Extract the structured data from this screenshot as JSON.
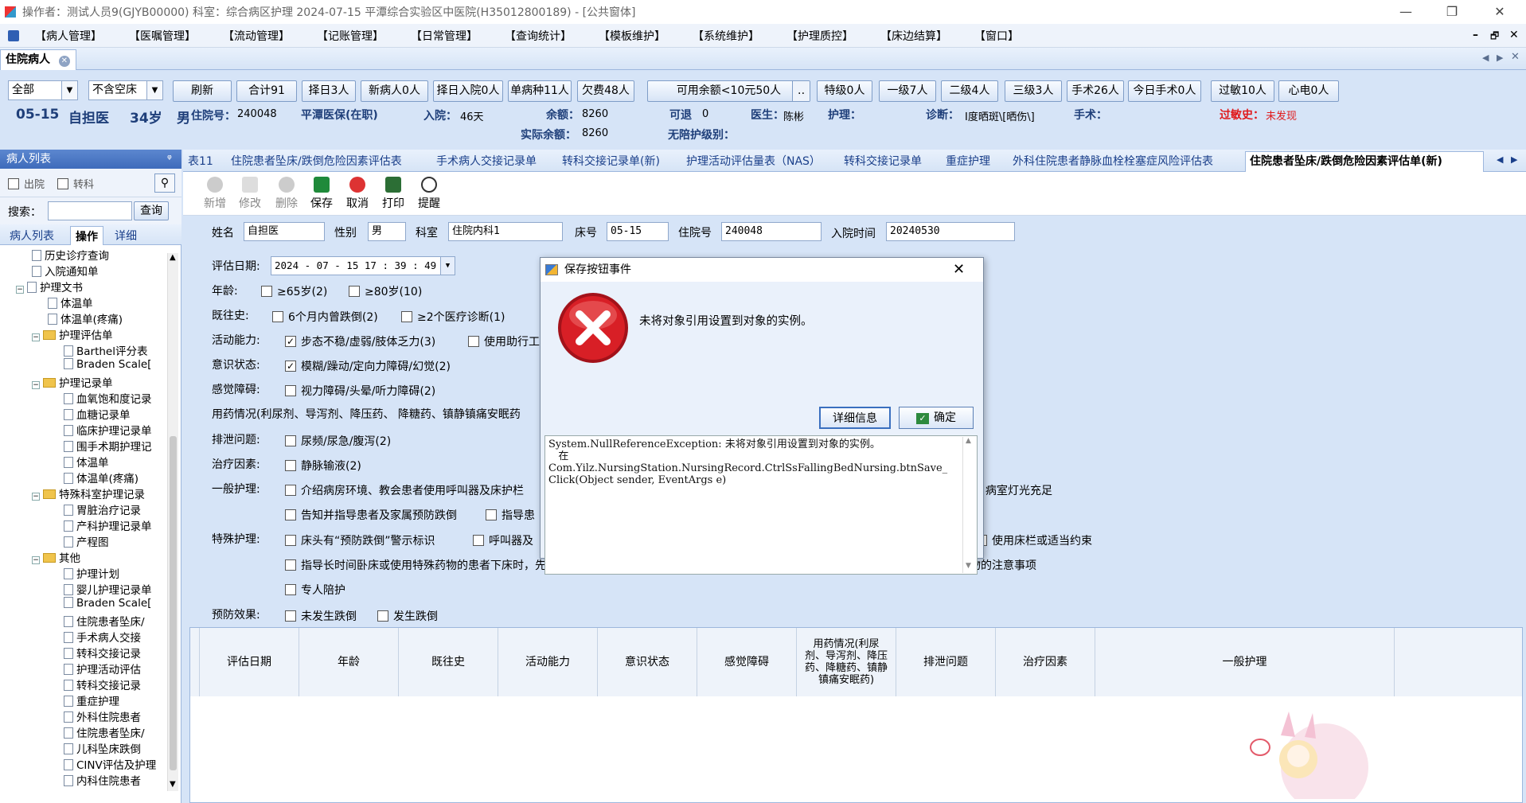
{
  "window": {
    "title": "操作者：测试人员9(GJYB00000) 科室：综合病区护理 2024-07-15 平潭综合实验区中医院(H35012800189) - [公共窗体]",
    "controls": [
      "—",
      "❐",
      "✕"
    ]
  },
  "menu": {
    "items": [
      "【病人管理】",
      "【医嘱管理】",
      "【流动管理】",
      "【记账管理】",
      "【日常管理】",
      "【查询统计】",
      "【模板维护】",
      "【系统维护】",
      "【护理质控】",
      "【床边结算】",
      "【窗口】"
    ],
    "right_controls": [
      "–",
      "🗗",
      "✕"
    ]
  },
  "main_tab": {
    "label": "住院病人"
  },
  "filters": {
    "scope": "全部",
    "bed_filter": "不含空床",
    "buttons": [
      "刷新",
      "合计91",
      "择日3人",
      "新病人0人",
      "择日入院0人",
      "单病种11人",
      "欠费48人",
      "可用余额<10元50人",
      "特级0人",
      "一级7人",
      "二级4人",
      "三级3人",
      "手术26人",
      "今日手术0人",
      "过敏10人",
      "心电0人"
    ]
  },
  "patient": {
    "bed": "05-15",
    "name": "自担医",
    "age": "34岁",
    "sex": "男",
    "admission_no_label": "住院号：",
    "admission_no": "240048",
    "insurance": "平潭医保(在职)",
    "admit_label": "入院：",
    "admit_days": "46天",
    "balance_label": "余额：",
    "balance": "8260",
    "actual_balance_label": "实际余额：",
    "actual_balance": "8260",
    "refund_label": "可退",
    "refund": "0",
    "doctor_label": "医生：",
    "doctor": "陈彬",
    "nurse_label": "护理：",
    "nurse": "",
    "no_escort_label": "无陪护级别：",
    "diagnosis_label": "诊断：",
    "diagnosis": "Ⅰ度晒斑\\[晒伤\\]",
    "surgery_label": "手术：",
    "allergy_label": "过敏史：",
    "allergy": "未发现"
  },
  "left_panel": {
    "title": "病人列表",
    "pin": "ᵠ",
    "discharged": "出院",
    "transfer": "转科",
    "search_label": "搜索：",
    "search_value": "",
    "query_button": "查询",
    "tabs": [
      "病人列表",
      "操作",
      "详细"
    ],
    "tree": [
      {
        "level": 1,
        "type": "doc",
        "label": "历史诊疗查询"
      },
      {
        "level": 1,
        "type": "doc",
        "label": "入院通知单"
      },
      {
        "level": 0,
        "type": "doc",
        "label": "护理文书",
        "expand": "−"
      },
      {
        "level": 2,
        "type": "doc",
        "label": "体温单"
      },
      {
        "level": 2,
        "type": "doc",
        "label": "体温单(疼痛)"
      },
      {
        "level": 1,
        "type": "folder",
        "label": "护理评估单",
        "expand": "−"
      },
      {
        "level": 3,
        "type": "doc",
        "label": "Barthel评分表"
      },
      {
        "level": 3,
        "type": "doc",
        "label": "Braden Scale["
      },
      {
        "level": 1,
        "type": "folder",
        "label": "护理记录单",
        "expand": "−"
      },
      {
        "level": 3,
        "type": "doc",
        "label": "血氧饱和度记录"
      },
      {
        "level": 3,
        "type": "doc",
        "label": "血糖记录单"
      },
      {
        "level": 3,
        "type": "doc",
        "label": "临床护理记录单"
      },
      {
        "level": 3,
        "type": "doc",
        "label": "围手术期护理记"
      },
      {
        "level": 3,
        "type": "doc",
        "label": "体温单"
      },
      {
        "level": 3,
        "type": "doc",
        "label": "体温单(疼痛)"
      },
      {
        "level": 1,
        "type": "folder",
        "label": "特殊科室护理记录",
        "expand": "−"
      },
      {
        "level": 3,
        "type": "doc",
        "label": "胃脏治疗记录"
      },
      {
        "level": 3,
        "type": "doc",
        "label": "产科护理记录单"
      },
      {
        "level": 3,
        "type": "doc",
        "label": "产程图"
      },
      {
        "level": 1,
        "type": "folder",
        "label": "其他",
        "expand": "−"
      },
      {
        "level": 3,
        "type": "doc",
        "label": "护理计划"
      },
      {
        "level": 3,
        "type": "doc",
        "label": "婴儿护理记录单"
      },
      {
        "level": 3,
        "type": "doc",
        "label": "Braden Scale["
      },
      {
        "level": 3,
        "type": "doc",
        "label": "住院患者坠床/"
      },
      {
        "level": 3,
        "type": "doc",
        "label": "手术病人交接"
      },
      {
        "level": 3,
        "type": "doc",
        "label": "转科交接记录"
      },
      {
        "level": 3,
        "type": "doc",
        "label": "护理活动评估"
      },
      {
        "level": 3,
        "type": "doc",
        "label": "转科交接记录"
      },
      {
        "level": 3,
        "type": "doc",
        "label": "重症护理"
      },
      {
        "level": 3,
        "type": "doc",
        "label": "外科住院患者"
      },
      {
        "level": 3,
        "type": "doc",
        "label": "住院患者坠床/"
      },
      {
        "level": 3,
        "type": "doc",
        "label": "儿科坠床跌倒"
      },
      {
        "level": 3,
        "type": "doc",
        "label": "CINV评估及护理"
      },
      {
        "level": 3,
        "type": "doc",
        "label": "内科住院患者"
      }
    ]
  },
  "doc_tabs": [
    "表11",
    "住院患者坠床/跌倒危险因素评估表",
    "手术病人交接记录单",
    "转科交接记录单(新)",
    "护理活动评估量表（NAS）",
    "转科交接记录单",
    "重症护理",
    "外科住院患者静脉血栓栓塞症风险评估表",
    "住院患者坠床/跌倒危险因素评估单(新)"
  ],
  "toolbar": [
    "新增",
    "修改",
    "删除",
    "保存",
    "取消",
    "打印",
    "提醒"
  ],
  "form": {
    "name_label": "姓名",
    "name": "自担医",
    "sex_label": "性别",
    "sex": "男",
    "dept_label": "科室",
    "dept": "住院内科1",
    "bed_label": "床号",
    "bed": "05-15",
    "adm_label": "住院号",
    "adm": "240048",
    "admit_time_label": "入院时间",
    "admit_time": "20240530",
    "eval_date_label": "评估日期:",
    "eval_date": "2024 - 07 - 15   17 : 39 : 49",
    "age_label": "年龄:",
    "age_opts": [
      "≥65岁(2)",
      "≥80岁(10)"
    ],
    "history_label": "既往史:",
    "history_opts": [
      "6个月内曾跌倒(2)",
      "≥2个医疗诊断(1)"
    ],
    "activity_label": "活动能力:",
    "activity_opts": [
      "步态不稳/虚弱/肢体乏力(3)",
      "使用助行工"
    ],
    "consciousness_label": "意识状态:",
    "consciousness_opts": [
      "模糊/躁动/定向力障碍/幻觉(2)"
    ],
    "sensory_label": "感觉障碍:",
    "sensory_opts": [
      "视力障碍/头晕/听力障碍(2)"
    ],
    "medication_label": "用药情况(利尿剂、导泻剂、降压药、 降糖药、镇静镇痛安眠药",
    "excretion_label": "排泄问题:",
    "excretion_opts": [
      "尿频/尿急/腹泻(2)"
    ],
    "treatment_label": "治疗因素:",
    "treatment_opts": [
      "静脉输液(2)"
    ],
    "general_label": "一般护理:",
    "general_opts_1": [
      "介绍病房环境、教会患者使用呼叫器及床护栏",
      "病室灯光充足"
    ],
    "general_opts_2": [
      "告知并指导患者及家属预防跌倒",
      "指导患"
    ],
    "special_label": "特殊护理:",
    "special_opts_1": [
      "床头有“预防跌倒”警示标识",
      "呼叫器及",
      "使用床栏或适当约束"
    ],
    "special_opts_2": [
      "指导长时间卧床或使用特殊药物的患者下床时，先坐在床沿片刻再起立行走，必要时协助其下床",
      "告知患者及家属服用特殊药物的注意事项"
    ],
    "special_opts_3": [
      "专人陪护"
    ],
    "effect_label": "预防效果:",
    "effect_opts": [
      "未发生跌倒",
      "发生跌倒"
    ]
  },
  "grid": {
    "headers": [
      "评估日期",
      "年龄",
      "既往史",
      "活动能力",
      "意识状态",
      "感觉障碍",
      "用药情况(利尿剂、导泻剂、降压药、降糖药、镇静镇痛安眠药)",
      "排泄问题",
      "治疗因素",
      "一般护理"
    ]
  },
  "dialog": {
    "title": "保存按钮事件",
    "message": "未将对象引用设置到对象的实例。",
    "details_button": "详细信息",
    "ok_button": "确定",
    "details": "System.NullReferenceException: 未将对象引用设置到对象的实例。\n   在\nCom.Yilz.NursingStation.NursingRecord.CtrlSsFallingBedNursing.btnSave_\nClick(Object sender, EventArgs e)",
    "close": "✕"
  },
  "colors": {
    "accent": "#3e6bbb",
    "error_red": "#d81f26",
    "allergy_red": "#e0191b",
    "panel_bg": "#d6e4f7"
  }
}
